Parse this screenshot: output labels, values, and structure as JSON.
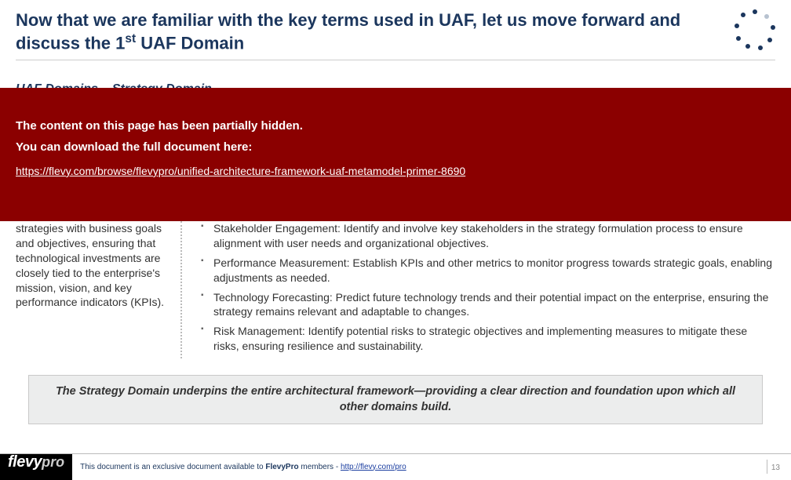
{
  "header": {
    "title_pre": "Now that we are familiar with the key terms used in UAF, let us move forward and discuss the 1",
    "title_sup": "st",
    "title_post": " UAF Domain"
  },
  "subheading": "UAF Domains – Strategy Domain",
  "overlay": {
    "line1": "The content on this page has been partially hidden.",
    "line2": "You can download the full document here:",
    "link": "https://flevy.com/browse/flevypro/unified-architecture-framework-uaf-metamodel-primer-8690"
  },
  "left_column": "strategies with business goals and objectives, ensuring that technological investments are closely tied to the enterprise's mission, vision, and key performance indicators (KPIs).",
  "bullets": [
    "Stakeholder Engagement: Identify and involve key stakeholders in the strategy formulation process to ensure alignment with user needs and organizational objectives.",
    "Performance Measurement: Establish KPIs and other metrics to monitor progress towards strategic goals, enabling adjustments as needed.",
    "Technology Forecasting: Predict future technology trends and their potential impact on the enterprise, ensuring the strategy remains relevant and adaptable to changes.",
    "Risk Management: Identify potential risks to strategic objectives and implementing measures to mitigate these risks, ensuring resilience and sustainability."
  ],
  "callout": "The Strategy Domain underpins the entire architectural framework—providing a clear direction and foundation upon which all other domains build.",
  "footer": {
    "logo_part1": "flevy",
    "logo_part2": "pro",
    "text_pre": "This document is an exclusive document available to ",
    "text_bold": "FlevyPro",
    "text_post": " members - ",
    "link": "http://flevy.com/pro",
    "page": "13"
  }
}
